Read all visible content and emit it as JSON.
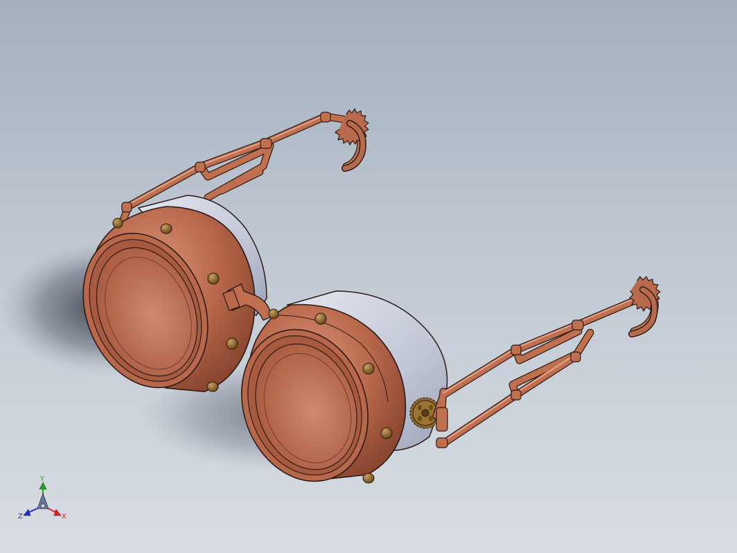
{
  "viewport": {
    "background_top": "#a3afbf",
    "background_bottom": "#d8dde3",
    "model": "steampunk-goggles"
  },
  "colors": {
    "copper": "#b8674a",
    "copper_dark": "#7a3a26",
    "copper_light": "#d48a6c",
    "silver": "#c6cbd8",
    "brass": "#8d6a2a",
    "edge": "#2b1a14"
  },
  "triad": {
    "x_label": "X",
    "y_label": "Y",
    "z_label": "Z",
    "x_color": "#e02020",
    "y_color": "#1fa01f",
    "z_color": "#2030d0"
  }
}
